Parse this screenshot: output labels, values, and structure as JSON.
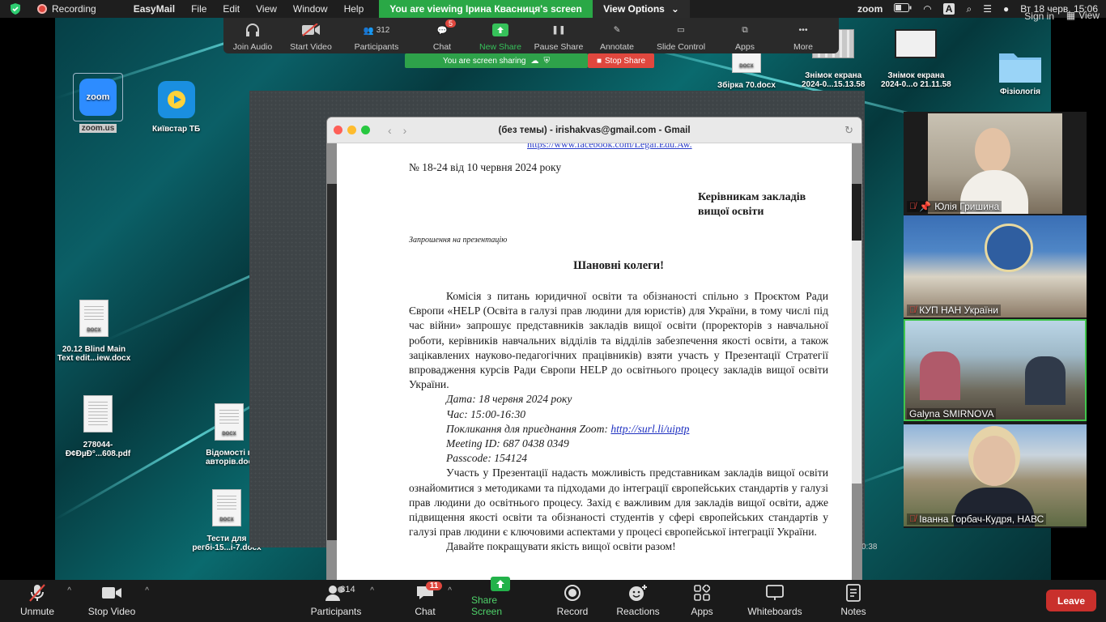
{
  "menubar": {
    "recording": "Recording",
    "app": "EasyMail",
    "items": [
      "File",
      "Edit",
      "View",
      "Window",
      "Help"
    ],
    "zoom_label": "zoom",
    "a_label": "A",
    "datetime": "Вт 18 черв.  15:06"
  },
  "banner": {
    "viewing": "You are viewing Ірина Квасниця's screen",
    "view_options": "View Options"
  },
  "top_right": {
    "sign_in": "Sign in",
    "view": "View"
  },
  "presenter_toolbar": {
    "join_audio": "Join Audio",
    "start_video": "Start Video",
    "participants": "Participants",
    "participants_count": "312",
    "chat": "Chat",
    "chat_badge": "5",
    "new_share": "New Share",
    "pause_share": "Pause Share",
    "annotate": "Annotate",
    "slide_control": "Slide Control",
    "apps": "Apps",
    "more": "More"
  },
  "sharing": {
    "status": "You are screen sharing",
    "stop": "Stop Share"
  },
  "desktop_icons": {
    "zoom": "zoom.us",
    "zoom_logo": "zoom",
    "kyivstar": "Київстар ТБ",
    "zbirka": "Збірка 70.docx",
    "shot1_line1": "Знімок екрана",
    "shot1_line2": "2024-0...15.13.58",
    "shot2_line1": "Знімок екрана",
    "shot2_line2": "2024-0...о 21.11.58",
    "physiology": "Фізіологія",
    "blind_line1": "20.12 Blind Main",
    "blind_line2": "Text edit...iew.docx",
    "pdf_line1": "278044-",
    "pdf_line2": "Ð¢ÐµÐ°...608.pdf",
    "vidomosti_line1": "Відомості п",
    "vidomosti_line2": "авторів.doc",
    "testy_line1": "Тести для",
    "testy_line2": "регбі-15...і-7.docx",
    "time_fragment": "0:38"
  },
  "browser": {
    "title": "(без темы) - irishakvas@gmail.com - Gmail"
  },
  "letter": {
    "link_top": "https://www.facebook.com/Legal.Edu.Aw.",
    "number": "№ 18-24 від 10 червня 2024 року",
    "recipients_line1": "Керівникам закладів",
    "recipients_line2": "вищої освіти",
    "invitation": "Запрошення на презентацію",
    "greeting": "Шановні колеги!",
    "para1": "Комісія з питань юридичної освіти та обізнаності спільно з Проєктом Ради Європи «HELP (Освіта в галузі прав людини для юристів) для України, в тому числі під час війни» запрошує представників закладів вищої освіти (проректорів з навчальної роботи, керівників навчальних відділів та відділів забезпечення якості освіти, а також зацікавлених науково-педагогічних працівників) взяти участь у Презентації Стратегії впровадження курсів Ради Європи HELP до освітнього процесу закладів вищої освіти України.",
    "date": "Дата: 18 червня 2024 року",
    "time": "Час: 15:00-16:30",
    "zoom_label": "Покликання для приєднання Zoom: ",
    "zoom_link": "http://surl.li/uiptp",
    "meeting_id": "Meeting ID: 687 0438 0349",
    "passcode": "Passcode: 154124",
    "para2": "Участь у Презентації надасть можливість представникам закладів вищої освіти ознайомитися з методиками та підходами до інтеграції європейських стандартів у галузі прав людини до освітнього процесу. Захід є важливим для закладів вищої освіти, адже підвищення якості освіти та обізнаності студентів у сфері європейських стандартів у галузі прав людини є ключовими аспектами у процесі європейської інтеграції України.",
    "closing": "Давайте покращувати якість вищої освіти разом!"
  },
  "participants": [
    {
      "name": "Юлія Гришина"
    },
    {
      "name": "КУП НАН України"
    },
    {
      "name": "Galyna SMIRNOVA"
    },
    {
      "name": "Іванна Горбач-Кудря, НАВС"
    }
  ],
  "bottom_toolbar": {
    "unmute": "Unmute",
    "stop_video": "Stop Video",
    "participants": "Participants",
    "participants_count": "314",
    "chat": "Chat",
    "chat_badge": "11",
    "share_screen": "Share Screen",
    "record": "Record",
    "reactions": "Reactions",
    "apps": "Apps",
    "whiteboards": "Whiteboards",
    "notes": "Notes",
    "leave": "Leave"
  },
  "colors": {
    "green": "#2aa846",
    "red": "#e0473e",
    "toolbar": "#1a1a1a",
    "desktop": "#0b5f66"
  }
}
